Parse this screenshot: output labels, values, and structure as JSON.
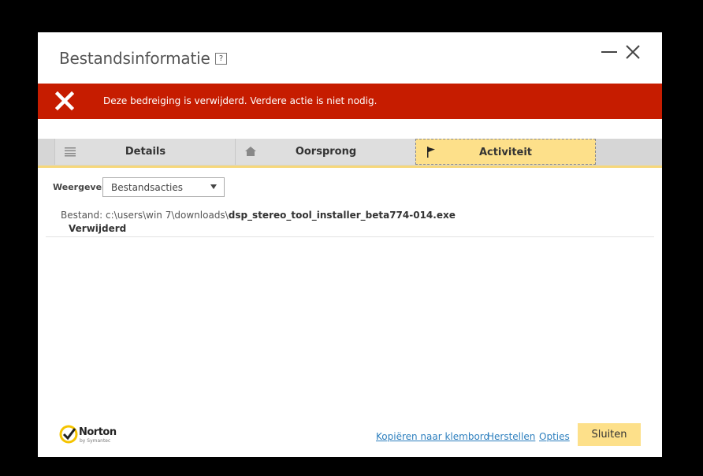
{
  "window": {
    "title": "Bestandsinformatie",
    "help_label": "?",
    "minimize_icon": "minimize-icon",
    "close_icon": "close-icon"
  },
  "banner": {
    "icon": "x-icon",
    "message": "Deze bedreiging is verwijderd. Verdere actie is niet nodig.",
    "color": "#c61c00"
  },
  "tabs": [
    {
      "label": "Details",
      "icon": "list-icon",
      "active": false
    },
    {
      "label": "Oorsprong",
      "icon": "home-icon",
      "active": false
    },
    {
      "label": "Activiteit",
      "icon": "flag-icon",
      "active": true
    }
  ],
  "view": {
    "label": "Weergeven",
    "selected": "Bestandsacties"
  },
  "file": {
    "prefix": "Bestand: c:\\users\\win 7\\downloads\\",
    "name": "dsp_stereo_tool_installer_beta774-014.exe",
    "status": "Verwijderd"
  },
  "footer": {
    "brand": "Norton",
    "brand_sub": "by Symantec",
    "links": [
      "Kopiëren naar klembord",
      "Herstellen",
      "Opties"
    ],
    "close_label": "Sluiten",
    "accent": "#fde08a"
  }
}
